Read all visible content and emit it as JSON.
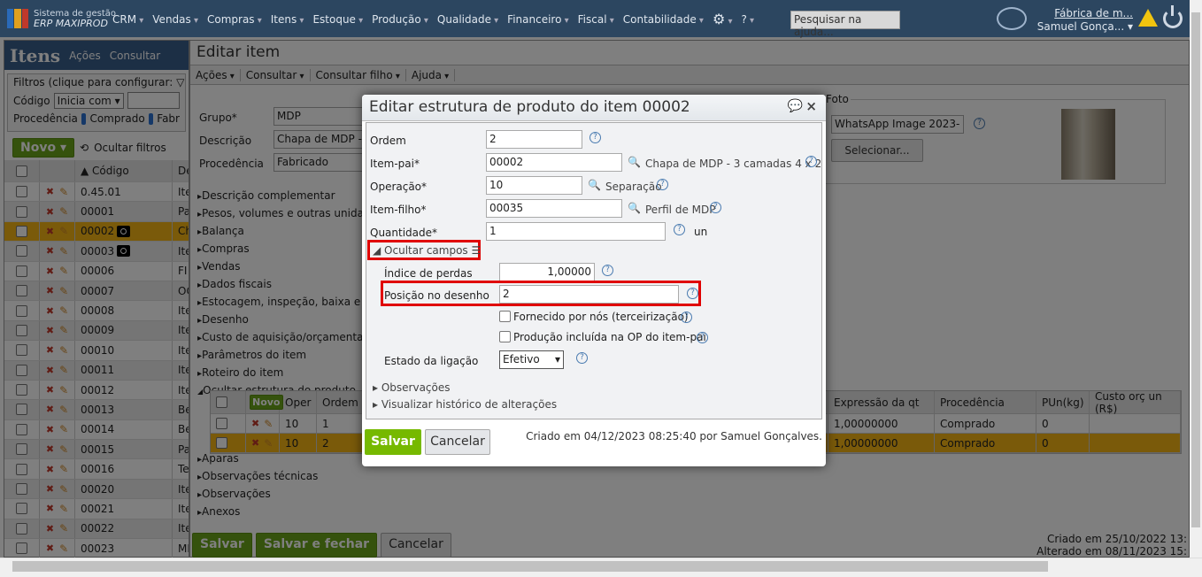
{
  "topnav": {
    "logo_line1": "Sistema de gestão",
    "logo_line2": "ERP MAXIPROD",
    "menu": [
      "CRM",
      "Vendas",
      "Compras",
      "Itens",
      "Estoque",
      "Produção",
      "Qualidade",
      "Financeiro",
      "Fiscal",
      "Contabilidade"
    ],
    "help_search_placeholder": "Pesquisar na ajuda...",
    "company": "Fábrica de m...",
    "user": "Samuel Gonça..."
  },
  "left_panel": {
    "title": "Itens",
    "menu": [
      "Ações",
      "Consultar"
    ],
    "filters_legend": "Filtros (clique para configurar:",
    "code_label": "Código",
    "code_filter": "Inicia com",
    "procedencia_label": "Procedência",
    "proc_options": [
      "Comprado",
      "Fabr"
    ],
    "new_label": "Novo",
    "hide_filters": "Ocultar filtros",
    "col_code": "▲ Código",
    "col_desc": "De",
    "rows": [
      {
        "code": "0.45.01",
        "desc": "Ite"
      },
      {
        "code": "00001",
        "desc": "Pa"
      },
      {
        "code": "00002",
        "desc": "Ch",
        "selected": true,
        "photo": true
      },
      {
        "code": "00003",
        "desc": "Ite",
        "photo": true
      },
      {
        "code": "00006",
        "desc": "FI"
      },
      {
        "code": "00007",
        "desc": "OC"
      },
      {
        "code": "00008",
        "desc": "Ite"
      },
      {
        "code": "00009",
        "desc": "Ite"
      },
      {
        "code": "00010",
        "desc": "Ite"
      },
      {
        "code": "00011",
        "desc": "Ite"
      },
      {
        "code": "00012",
        "desc": "Ite"
      },
      {
        "code": "00013",
        "desc": "Be"
      },
      {
        "code": "00014",
        "desc": "Be"
      },
      {
        "code": "00015",
        "desc": "Pa"
      },
      {
        "code": "00016",
        "desc": "Te"
      },
      {
        "code": "00020",
        "desc": "Ite"
      },
      {
        "code": "00021",
        "desc": "Ite"
      },
      {
        "code": "00022",
        "desc": "Ite"
      },
      {
        "code": "00023",
        "desc": "MI"
      }
    ]
  },
  "edit_item": {
    "title": "Editar item",
    "menu": [
      "Ações",
      "Consultar",
      "Consultar filho",
      "Ajuda"
    ],
    "grupo_label": "Grupo*",
    "grupo": "MDP",
    "descricao_label": "Descrição",
    "descricao": "Chapa de MDP - 3",
    "procedencia_label": "Procedência",
    "procedencia": "Fabricado",
    "foto_label": "Foto",
    "foto_select": "WhatsApp Image 2023-",
    "foto_button": "Selecionar...",
    "sections_top": [
      "Descrição complementar",
      "Pesos, volumes e outras unidades",
      "Balança",
      "Compras",
      "Vendas",
      "Dados fiscais",
      "Estocagem, inspeção, baixa e pl",
      "Desenho",
      "Custo de aquisição/orçamentação",
      "Parâmetros do item",
      "Roteiro do item"
    ],
    "structure_section": "Ocultar estrutura do produto",
    "structure": {
      "new_label": "Novo",
      "headers": [
        "Oper",
        "Ordem",
        "Expressão da qt",
        "Procedência",
        "PUn(kg)",
        "Custo orç un (R$)"
      ],
      "rows": [
        {
          "oper": "10",
          "ordem": "1",
          "expr": "1,00000000",
          "proc": "Comprado",
          "pun": "0",
          "custo": ""
        },
        {
          "oper": "10",
          "ordem": "2",
          "expr": "1,00000000",
          "proc": "Comprado",
          "pun": "0",
          "custo": "",
          "selected": true
        }
      ]
    },
    "sections_bottom": [
      "Aparas",
      "Observações técnicas",
      "Observações",
      "Anexos"
    ],
    "save": "Salvar",
    "save_close": "Salvar e fechar",
    "cancel": "Cancelar",
    "created": "Criado em 25/10/2022 13:",
    "altered": "Alterado em 08/11/2023 15:"
  },
  "dialog": {
    "title": "Editar estrutura de produto do item 00002",
    "ordem_label": "Ordem",
    "ordem": "2",
    "itempai_label": "Item-pai*",
    "itempai": "00002",
    "itempai_desc": "Chapa de MDP - 3 camadas 4 x 2",
    "operacao_label": "Operação*",
    "operacao": "10",
    "operacao_desc": "Separação",
    "itemfilho_label": "Item-filho*",
    "itemfilho": "00035",
    "itemfilho_desc": "Perfil de MDP",
    "quantidade_label": "Quantidade*",
    "quantidade": "1",
    "unit": "un",
    "hide_fields": "Ocultar campos",
    "indice_label": "Índice de perdas",
    "indice": "1,00000",
    "posicao_label": "Posição no desenho",
    "posicao": "2",
    "fornecido_label": "Fornecido por nós (terceirização)",
    "producao_label": "Produção incluída na OP do item-pai",
    "estado_label": "Estado da ligação",
    "estado": "Efetivo",
    "observacoes": "Observações",
    "historico": "Visualizar histórico de alterações",
    "save": "Salvar",
    "cancel": "Cancelar",
    "created": "Criado em 04/12/2023 08:25:40 por Samuel Gonçalves."
  },
  "colors": {
    "accent_green": "#76b900",
    "nav": "#2c4660",
    "highlight": "#e00000",
    "selected_row": "#f4b414"
  }
}
